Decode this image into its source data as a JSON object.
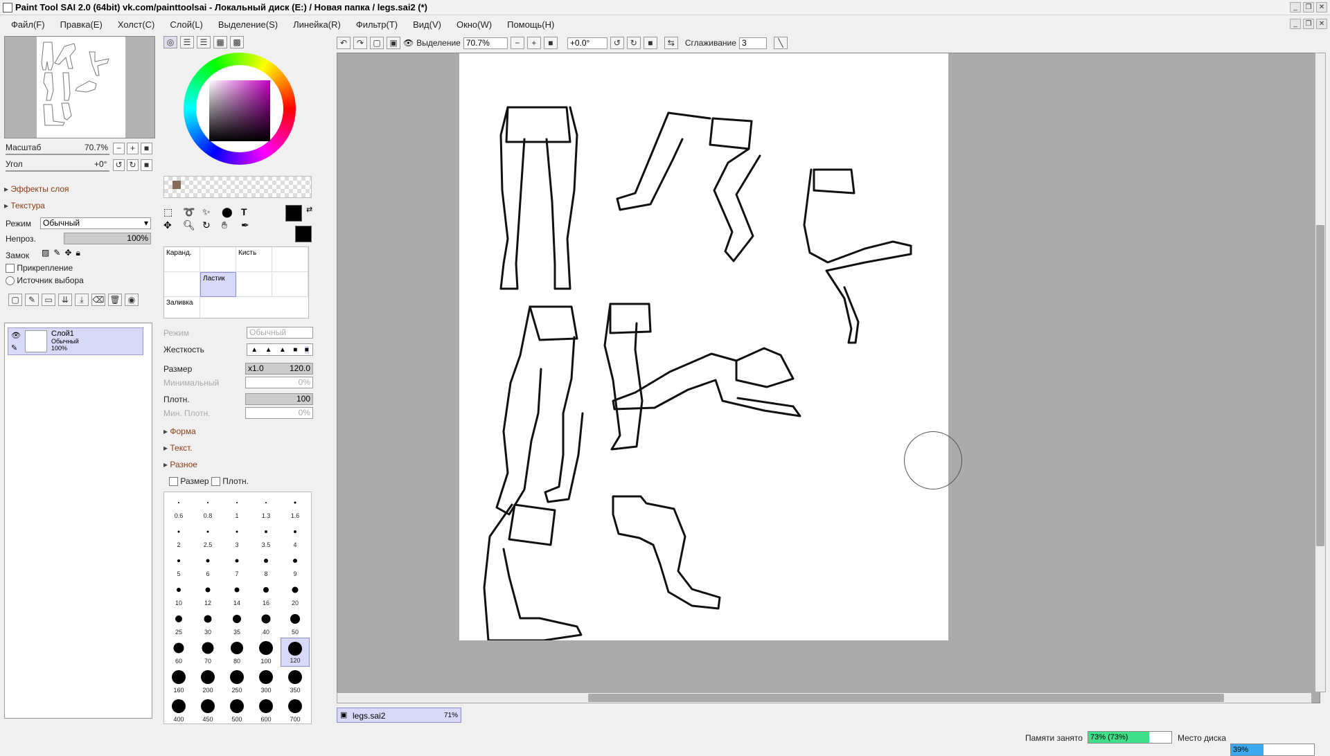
{
  "window": {
    "title": "Paint Tool SAI 2.0 (64bit) vk.com/painttoolsai - Локальный диск (E:) / Новая папка / legs.sai2 (*)"
  },
  "menu": [
    "Файл(F)",
    "Правка(E)",
    "Холст(C)",
    "Слой(L)",
    "Выделение(S)",
    "Линейка(R)",
    "Фильтр(T)",
    "Вид(V)",
    "Окно(W)",
    "Помощь(H)"
  ],
  "navigator": {
    "zoom_label": "Масштаб",
    "zoom_value": "70.7%",
    "angle_label": "Угол",
    "angle_value": "+0°"
  },
  "layer_panel": {
    "effects_label": "Эффекты слоя",
    "texture_label": "Текстура",
    "mode_label": "Режим",
    "mode_value": "Обычный",
    "opacity_label": "Непроз.",
    "opacity_value": "100%",
    "opacity_fraction": 1.0,
    "lock_label": "Замок",
    "clipping_label": "Прикрепление",
    "selection_source_label": "Источник выбора",
    "layer": {
      "name": "Слой1",
      "mode": "Обычный",
      "opacity": "100%"
    }
  },
  "tools": {
    "pencil": "Каранд.",
    "brush": "Кисть",
    "eraser": "Ластик",
    "fill": "Заливка"
  },
  "brush_settings": {
    "mode_label": "Режим",
    "mode_value": "Обычный",
    "hardness_label": "Жесткость",
    "size_label": "Размер",
    "size_mult": "x1.0",
    "size_value": "120.0",
    "min_label": "Минимальный",
    "min_value": "0%",
    "density_label": "Плотн.",
    "density_value": "100",
    "min_density_label": "Мин. Плотн.",
    "min_density_value": "0%",
    "shape_label": "Форма",
    "texture_label": "Текст.",
    "misc_label": "Разное",
    "size_check": "Размер",
    "density_check": "Плотн."
  },
  "brush_sizes": [
    "0.6",
    "0.8",
    "1",
    "1.3",
    "1.6",
    "2",
    "2.5",
    "3",
    "3.5",
    "4",
    "5",
    "6",
    "7",
    "8",
    "9",
    "10",
    "12",
    "14",
    "16",
    "20",
    "25",
    "30",
    "35",
    "40",
    "50",
    "60",
    "70",
    "80",
    "100",
    "120",
    "160",
    "200",
    "250",
    "300",
    "350",
    "400",
    "450",
    "500",
    "600",
    "700"
  ],
  "selected_size": "120",
  "canvas_toolbar": {
    "selection_label": "Выделение",
    "zoom": "70.7%",
    "angle": "+0.0°",
    "stabilizer_label": "Сглаживание",
    "stabilizer_value": "3"
  },
  "document_tab": {
    "name": "legs.sai2",
    "zoom": "71%"
  },
  "status": {
    "memory_label": "Памяти занято",
    "memory_value": "73% (73%)",
    "memory_fraction": 0.73,
    "disk_label": "Место диска",
    "disk_value": "39%",
    "disk_fraction": 0.39
  },
  "colors": {
    "accent_layer": "#d8d8f8",
    "memory_fill": "#3ee08a",
    "disk_fill": "#3aa9f0",
    "section_text": "#8a3a15"
  }
}
